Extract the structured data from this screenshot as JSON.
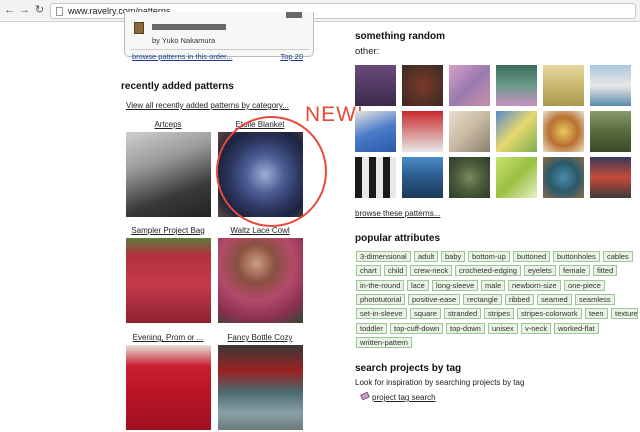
{
  "browser": {
    "url": "www.ravelry.com/patterns",
    "back": "←",
    "forward": "→",
    "reload": "↻"
  },
  "top_box": {
    "author": "by Yuko Nakamura",
    "browse_order": "browse patterns in this order...",
    "top20": "Top 20"
  },
  "recent": {
    "heading": "recently added patterns",
    "view_all": "View all recently added patterns by category...",
    "patterns": [
      {
        "title": "Artceps"
      },
      {
        "title": "Etoile Blanket"
      },
      {
        "title": "Sampler Project Bag"
      },
      {
        "title": "Waltz Lace Cowl"
      },
      {
        "title": "Evening, Prom or ..."
      },
      {
        "title": "Fancy Bottle Cozy"
      }
    ],
    "annotation": "NEW!",
    "annotation_color": "#e84a3a"
  },
  "random": {
    "heading": "something random",
    "other": "other:",
    "browse_these": "browse these patterns..."
  },
  "popular": {
    "heading": "popular attributes",
    "tags": [
      "3-dimensional",
      "adult",
      "baby",
      "bottom-up",
      "buttoned",
      "buttonholes",
      "cables",
      "chart",
      "child",
      "crew-neck",
      "crocheted-edging",
      "eyelets",
      "female",
      "fitted",
      "in-the-round",
      "lace",
      "long-sleeve",
      "male",
      "newborn-size",
      "one-piece",
      "phototutorial",
      "positive-ease",
      "rectangle",
      "ribbed",
      "seamed",
      "seamless",
      "set-in-sleeve",
      "square",
      "stranded",
      "stripes",
      "stripes-colorwork",
      "teen",
      "textured",
      "toddler",
      "top-cuff-down",
      "top-down",
      "unisex",
      "v-neck",
      "worked-flat",
      "written-pattern"
    ]
  },
  "search": {
    "heading": "search projects by tag",
    "look": "Look for inspiration by searching projects by tag",
    "link": "project tag search"
  },
  "colors": {
    "tag_bg": "#e9f4e5",
    "tag_border": "#9fc49a",
    "link": "#1a3d8f"
  }
}
